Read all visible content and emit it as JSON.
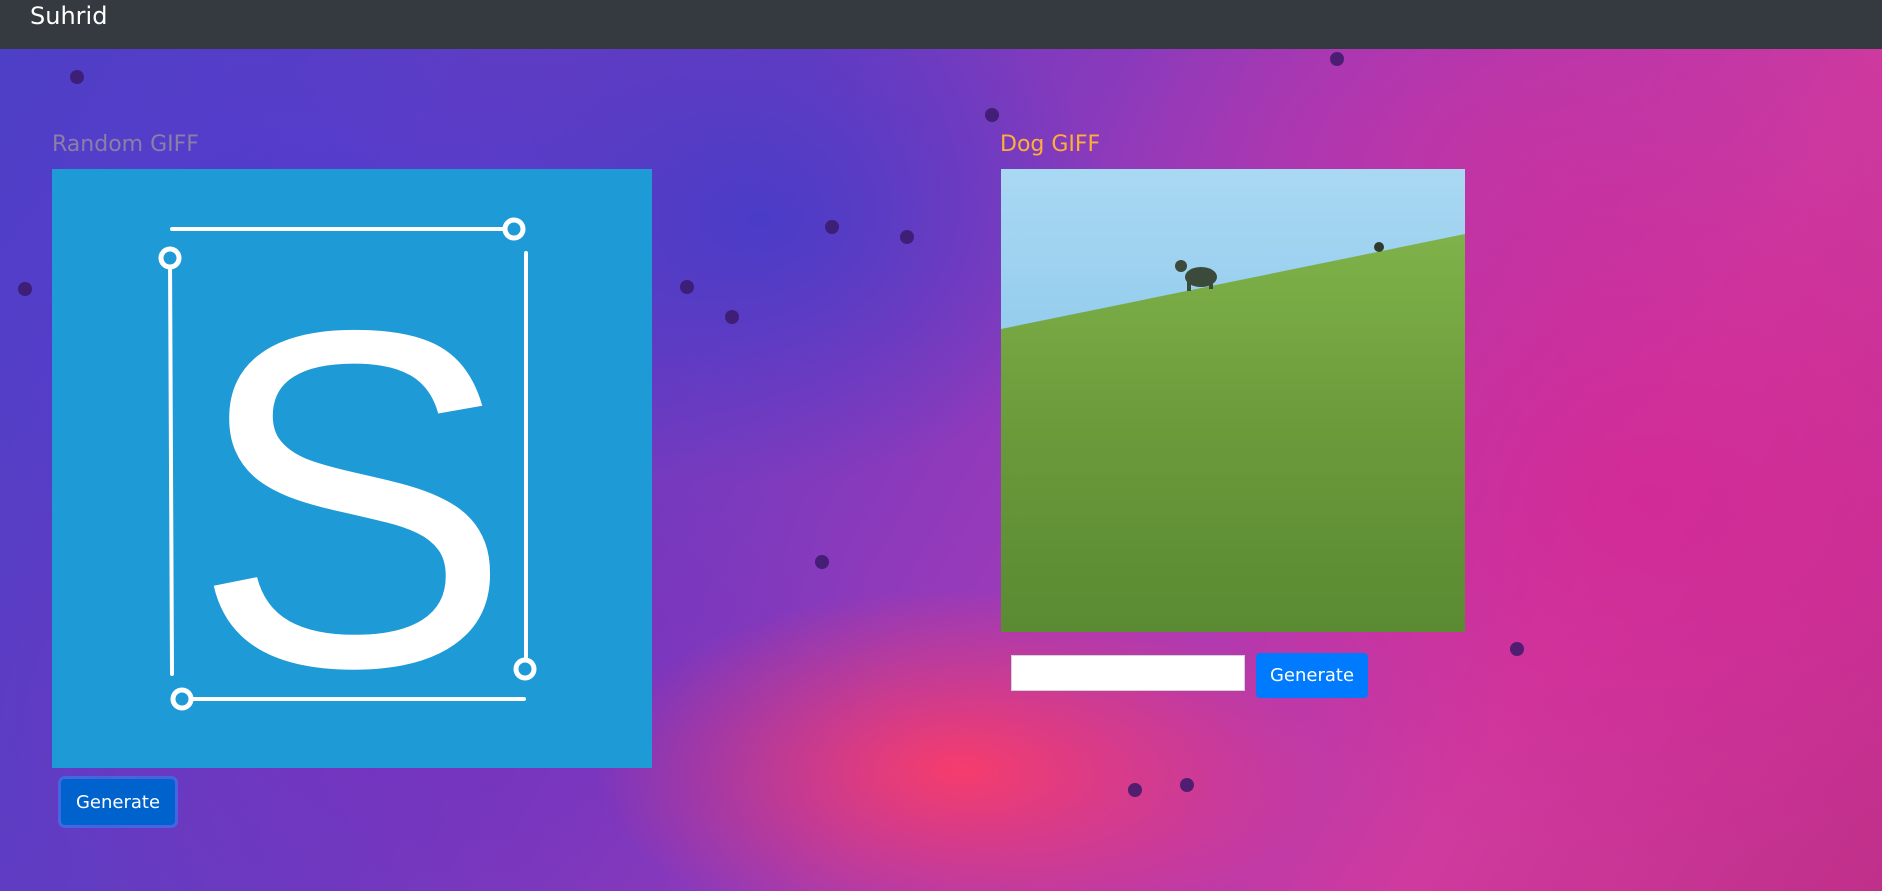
{
  "navbar": {
    "brand": "Suhrid"
  },
  "random_panel": {
    "title": "Random GIFF",
    "image_letter": "S",
    "generate_label": "Generate"
  },
  "dog_panel": {
    "title": "Dog GIFF",
    "search_value": "",
    "search_placeholder": "",
    "generate_label": "Generate"
  },
  "colors": {
    "navbar_bg": "#343a40",
    "random_title": "#8a7fa6",
    "dog_title": "#ffae3a",
    "button_primary": "#007bff",
    "logo_bg": "#1e9ad6"
  }
}
